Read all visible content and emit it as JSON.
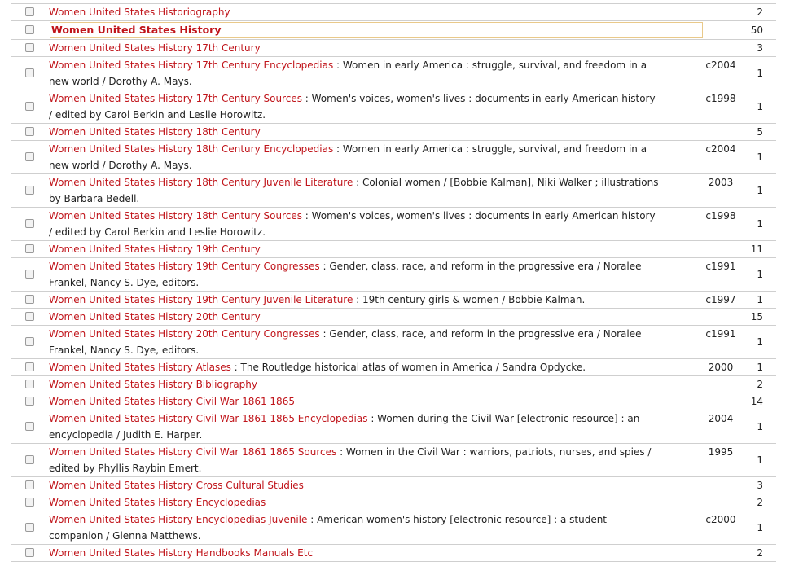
{
  "rows": [
    {
      "subject": "Women United States Historiography",
      "title": "",
      "year": "",
      "count": "2"
    },
    {
      "subject": "Women United States History",
      "title": "",
      "year": "",
      "count": "50",
      "highlight": true
    },
    {
      "subject": "Women United States History 17th Century",
      "title": "",
      "year": "",
      "count": "3"
    },
    {
      "subject": "Women United States History 17th Century Encyclopedias",
      "title": "Women in early America : struggle, survival, and freedom in a new world / Dorothy A. Mays.",
      "year": "c2004",
      "count": "1"
    },
    {
      "subject": "Women United States History 17th Century Sources",
      "title": "Women's voices, women's lives : documents in early American history / edited by Carol Berkin and Leslie Horowitz.",
      "year": "c1998",
      "count": "1"
    },
    {
      "subject": "Women United States History 18th Century",
      "title": "",
      "year": "",
      "count": "5"
    },
    {
      "subject": "Women United States History 18th Century Encyclopedias",
      "title": "Women in early America : struggle, survival, and freedom in a new world / Dorothy A. Mays.",
      "year": "c2004",
      "count": "1"
    },
    {
      "subject": "Women United States History 18th Century Juvenile Literature",
      "title": "Colonial women / [Bobbie Kalman], Niki Walker ; illustrations by Barbara Bedell.",
      "year": "2003",
      "count": "1"
    },
    {
      "subject": "Women United States History 18th Century Sources",
      "title": "Women's voices, women's lives : documents in early American history / edited by Carol Berkin and Leslie Horowitz.",
      "year": "c1998",
      "count": "1"
    },
    {
      "subject": "Women United States History 19th Century",
      "title": "",
      "year": "",
      "count": "11"
    },
    {
      "subject": "Women United States History 19th Century Congresses",
      "title": "Gender, class, race, and reform in the progressive era / Noralee Frankel, Nancy S. Dye, editors.",
      "year": "c1991",
      "count": "1"
    },
    {
      "subject": "Women United States History 19th Century Juvenile Literature",
      "title": "19th century girls & women / Bobbie Kalman.",
      "year": "c1997",
      "count": "1"
    },
    {
      "subject": "Women United States History 20th Century",
      "title": "",
      "year": "",
      "count": "15"
    },
    {
      "subject": "Women United States History 20th Century Congresses",
      "title": "Gender, class, race, and reform in the progressive era / Noralee Frankel, Nancy S. Dye, editors.",
      "year": "c1991",
      "count": "1"
    },
    {
      "subject": "Women United States History Atlases",
      "title": "The Routledge historical atlas of women in America / Sandra Opdycke.",
      "year": "2000",
      "count": "1"
    },
    {
      "subject": "Women United States History Bibliography",
      "title": "",
      "year": "",
      "count": "2"
    },
    {
      "subject": "Women United States History Civil War 1861 1865",
      "title": "",
      "year": "",
      "count": "14"
    },
    {
      "subject": "Women United States History Civil War 1861 1865 Encyclopedias",
      "title": "Women during the Civil War [electronic resource] : an encyclopedia / Judith E. Harper.",
      "year": "2004",
      "count": "1"
    },
    {
      "subject": "Women United States History Civil War 1861 1865 Sources",
      "title": "Women in the Civil War : warriors, patriots, nurses, and spies / edited by Phyllis Raybin Emert.",
      "year": "1995",
      "count": "1"
    },
    {
      "subject": "Women United States History Cross Cultural Studies",
      "title": "",
      "year": "",
      "count": "3"
    },
    {
      "subject": "Women United States History Encyclopedias",
      "title": "",
      "year": "",
      "count": "2"
    },
    {
      "subject": "Women United States History Encyclopedias Juvenile",
      "title": "American women's history [electronic resource] : a student companion / Glenna Matthews.",
      "year": "c2000",
      "count": "1"
    },
    {
      "subject": "Women United States History Handbooks Manuals Etc",
      "title": "",
      "year": "",
      "count": "2"
    }
  ]
}
